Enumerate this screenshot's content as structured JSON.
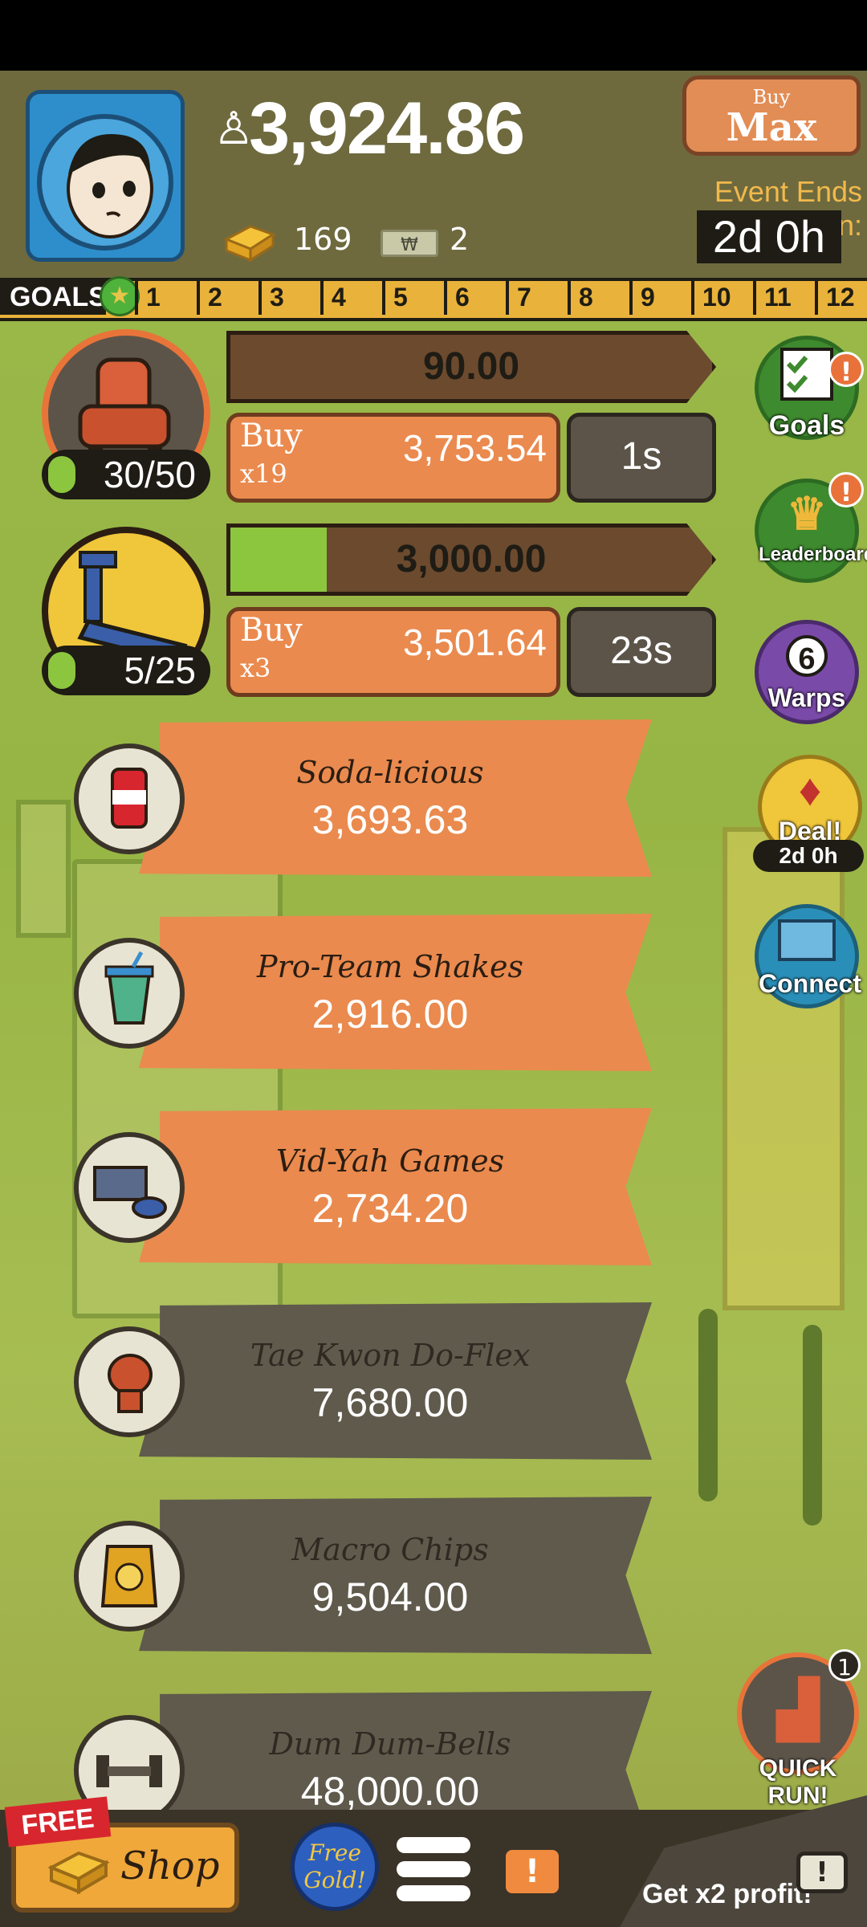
{
  "header": {
    "money": "3,924.86",
    "gold": "169",
    "bills": "2",
    "buy_max_top": "Buy",
    "buy_max_bottom": "Max",
    "event_label": "Event Ends in:",
    "event_value": "2d 0h"
  },
  "goals": {
    "label": "GOALS",
    "ticks": [
      "1",
      "2",
      "3",
      "4",
      "5",
      "6",
      "7",
      "8",
      "9",
      "10",
      "11",
      "12"
    ]
  },
  "owned": [
    {
      "icon": "recliner-icon",
      "count": "30/50",
      "revenue": "90.00",
      "progress": 0,
      "buy_label": "Buy",
      "buy_multiplier": "x19",
      "buy_price": "3,753.54",
      "time": "1s"
    },
    {
      "icon": "treadmill-icon",
      "count": "5/25",
      "revenue": "3,000.00",
      "progress": 0.2,
      "buy_label": "Buy",
      "buy_multiplier": "x3",
      "buy_price": "3,501.64",
      "time": "23s"
    }
  ],
  "businesses": [
    {
      "name": "Soda-licious",
      "price": "3,693.63",
      "state": "affordable",
      "icon": "soda-can-icon"
    },
    {
      "name": "Pro-Team Shakes",
      "price": "2,916.00",
      "state": "affordable",
      "icon": "shake-cup-icon"
    },
    {
      "name": "Vid-Yah Games",
      "price": "2,734.20",
      "state": "affordable",
      "icon": "game-console-icon"
    },
    {
      "name": "Tae Kwon Do-Flex",
      "price": "7,680.00",
      "state": "locked",
      "icon": "boxing-glove-icon"
    },
    {
      "name": "Macro Chips",
      "price": "9,504.00",
      "state": "locked",
      "icon": "chips-bag-icon"
    },
    {
      "name": "Dum Dum-Bells",
      "price": "48,000.00",
      "state": "locked",
      "icon": "dumbbell-icon"
    }
  ],
  "side": {
    "goals_label": "Goals",
    "leaderboard_label": "Leaderboard",
    "warps_label": "Warps",
    "warps_count": "6",
    "deal_label": "Deal!",
    "deal_time": "2d 0h",
    "connect_label": "Connect",
    "alert": "!"
  },
  "bottom": {
    "free_tag": "FREE",
    "shop_label": "Shop",
    "free_gold": "Free Gold!",
    "quick_run_label": "QUICK RUN!",
    "quick_run_badge": "1",
    "x2_label": "Get x2 profit!",
    "message_icon": "!"
  },
  "colors": {
    "orange": "#ea8a4e",
    "locked": "#5f5a4c",
    "progress_green": "#8cc63f",
    "background": "#9ab94a"
  }
}
